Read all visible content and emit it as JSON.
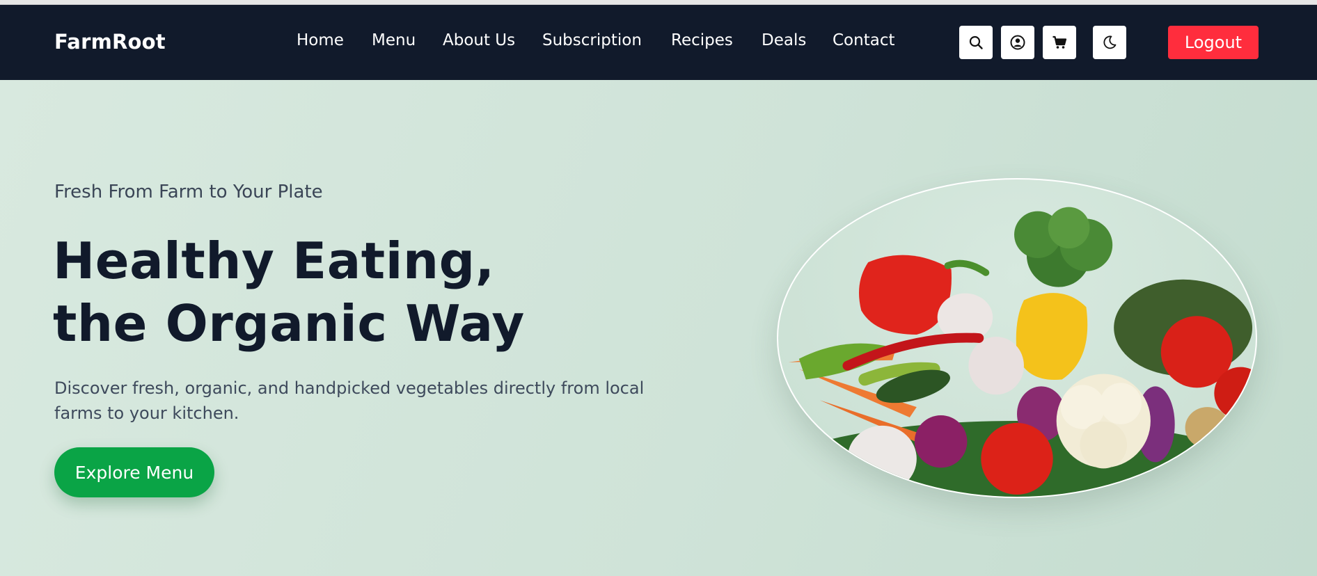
{
  "brand": "FarmRoot",
  "nav": {
    "links": [
      "Home",
      "Menu",
      "About Us",
      "Subscription",
      "Recipes",
      "Deals",
      "Contact"
    ],
    "icons": [
      "search-icon",
      "account-icon",
      "cart-icon",
      "moon-icon"
    ],
    "logout_label": "Logout"
  },
  "hero": {
    "eyebrow": "Fresh From Farm to Your Plate",
    "headline_line1": "Healthy Eating,",
    "headline_line2": "the Organic Way",
    "description": "Discover fresh, organic, and handpicked vegetables directly from local farms to your kitchen.",
    "cta_label": "Explore Menu"
  },
  "colors": {
    "navbar": "#111a2b",
    "hero_background": "#d3e6db",
    "logout": "#ff2d3d",
    "cta": "#0aa446"
  }
}
